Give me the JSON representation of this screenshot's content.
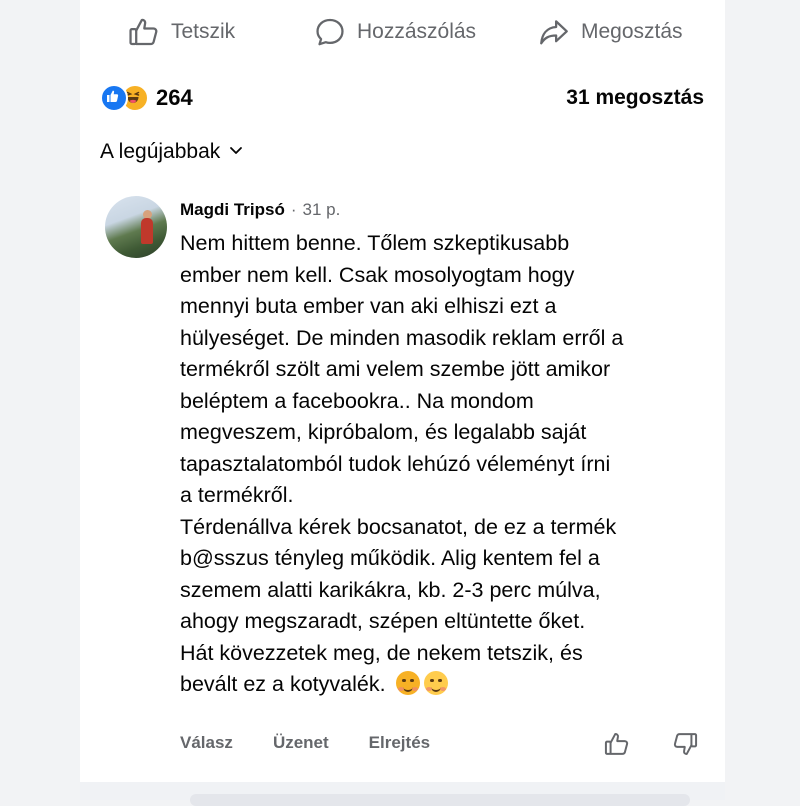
{
  "action_bar": {
    "like_label": "Tetszik",
    "comment_label": "Hozzászólás",
    "share_label": "Megosztás"
  },
  "reactions": {
    "icons": [
      "like-icon",
      "haha-icon"
    ],
    "count": "264",
    "shares": "31 megosztás"
  },
  "sort": {
    "label": "A legújabbak"
  },
  "comment": {
    "author": "Magdi Tripsó",
    "separator": "·",
    "time": "31 p.",
    "lines": [
      "Nem hittem benne. Tőlem szkeptikusabb",
      "ember nem kell. Csak mosolyogtam hogy",
      "mennyi buta ember van aki elhiszi ezt a",
      "hülyeséget. De minden masodik reklam erről a",
      "termékről szölt ami velem szembe jött amikor",
      "beléptem a facebookra.. Na mondom",
      "megveszem, kipróbalom, és legalabb saját",
      "tapasztalatomból tudok lehúzó véleményt írni",
      "a termékről.",
      "Térdenállva kérek bocsanatot, de ez a termék",
      "b@sszus tényleg működik. Alig kentem fel a",
      "szemem alatti karikákra, kb. 2-3 perc múlva,",
      "ahogy megszaradt, szépen eltüntette őket.",
      "Hát kövezzetek meg, de nekem tetszik, és",
      "bevált ez a kotyvalék."
    ],
    "trailing_emoji": [
      "hand-over-mouth-emoji",
      "smiling-blush-emoji"
    ],
    "actions": {
      "reply": "Válasz",
      "message": "Üzenet",
      "hide": "Elrejtés"
    }
  }
}
